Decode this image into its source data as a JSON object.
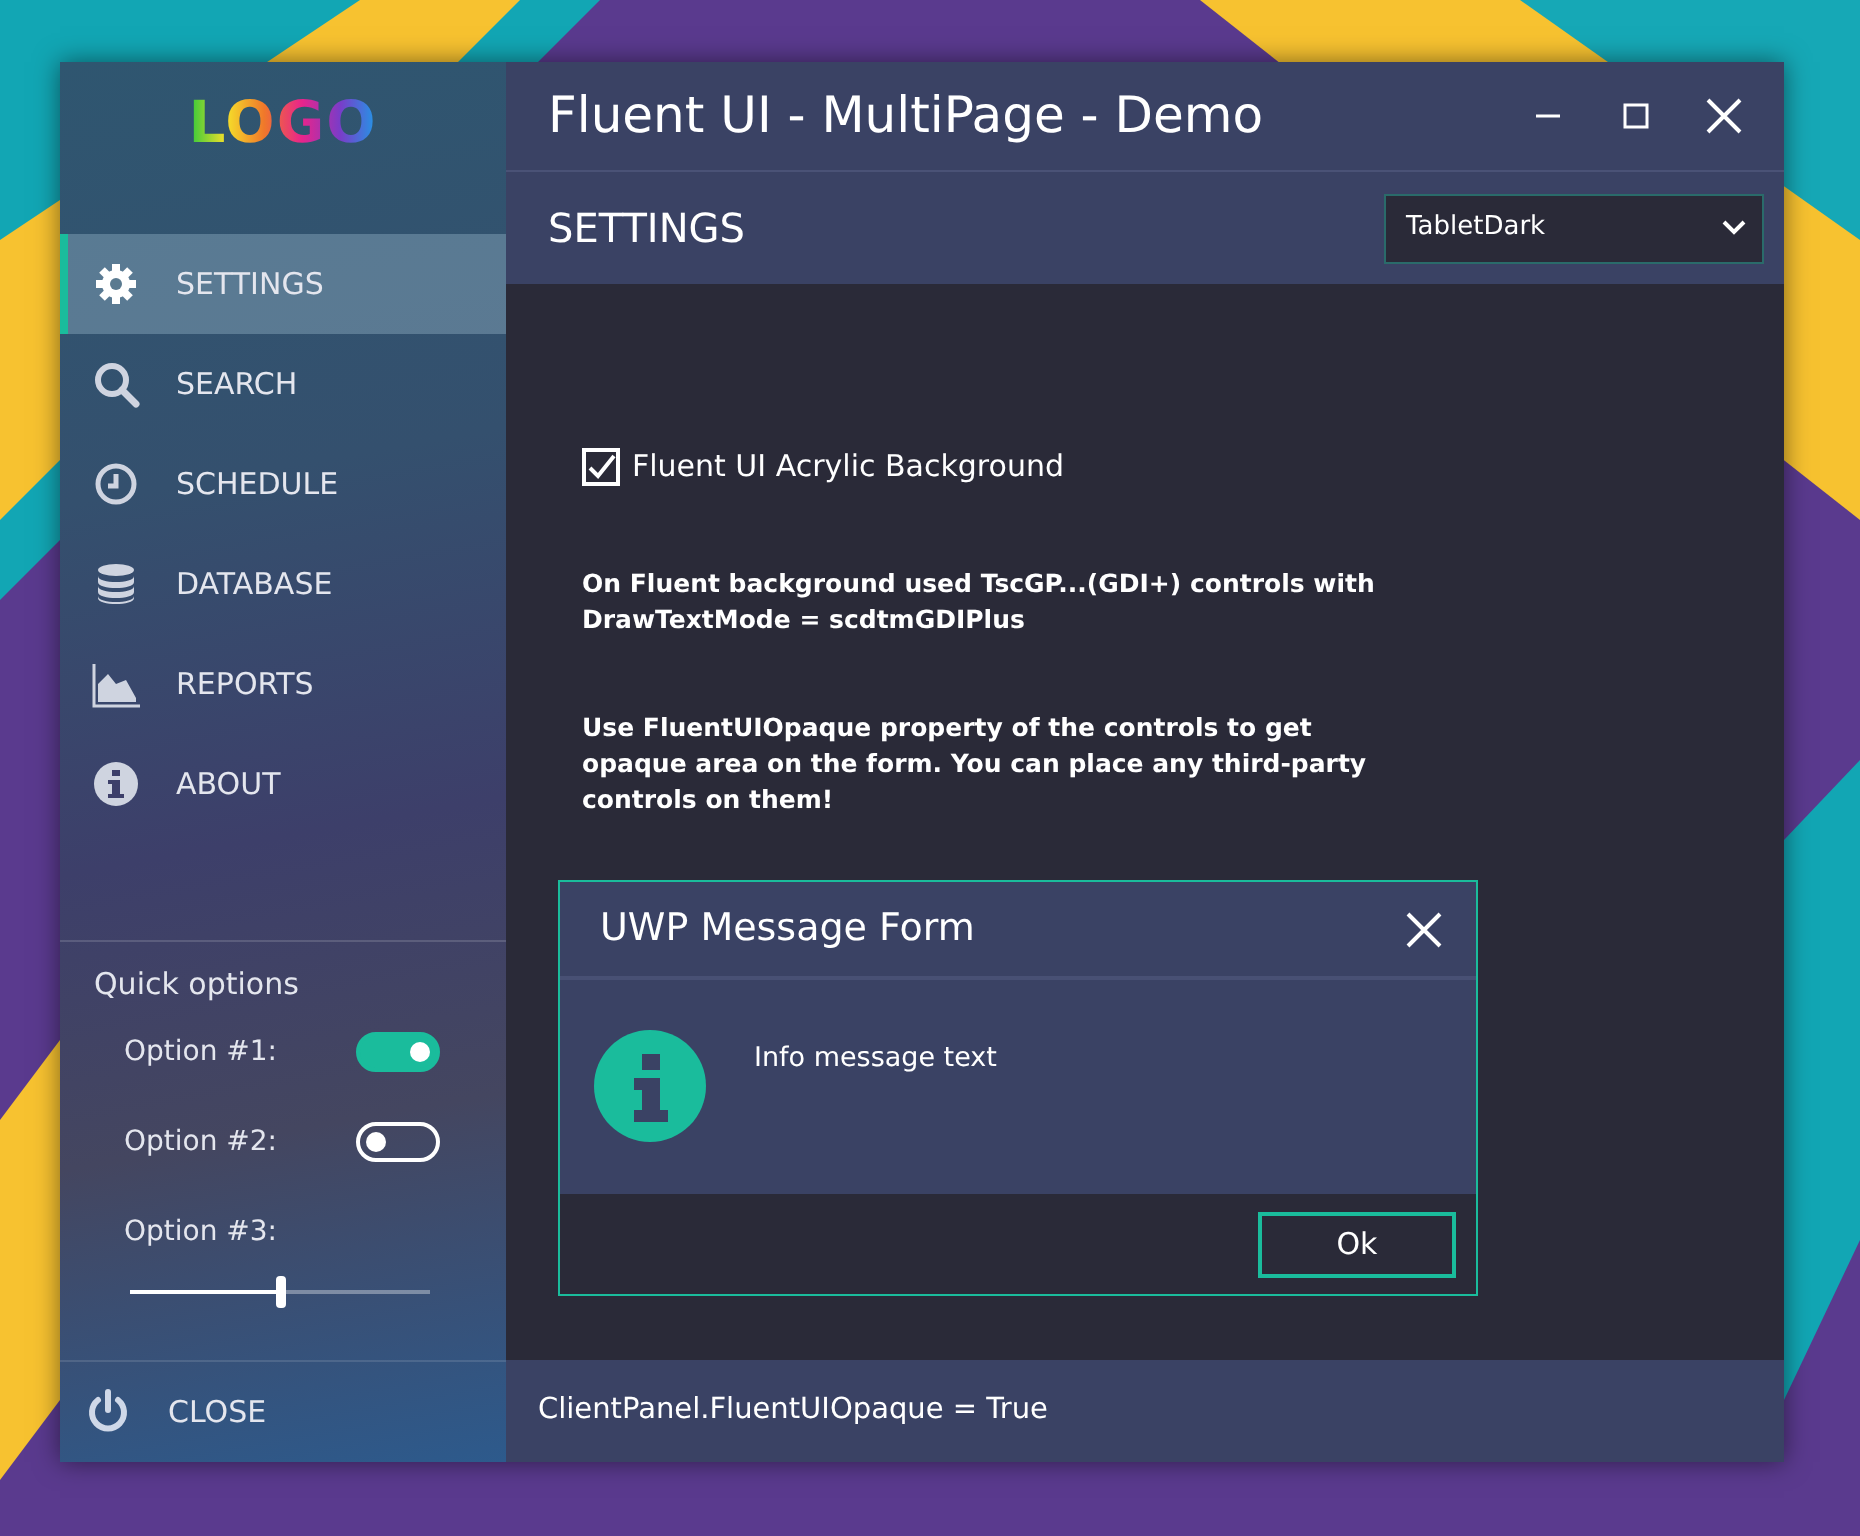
{
  "window": {
    "title": "Fluent UI - MultiPage - Demo"
  },
  "sidebar": {
    "logo": "LOGO",
    "items": [
      {
        "label": "SETTINGS",
        "selected": true
      },
      {
        "label": "SEARCH",
        "selected": false
      },
      {
        "label": "SCHEDULE",
        "selected": false
      },
      {
        "label": "DATABASE",
        "selected": false
      },
      {
        "label": "REPORTS",
        "selected": false
      },
      {
        "label": "ABOUT",
        "selected": false
      }
    ],
    "quick_options": {
      "title": "Quick options",
      "options": [
        {
          "label": "Option #1:",
          "kind": "toggle",
          "on": true
        },
        {
          "label": "Option #2:",
          "kind": "toggle",
          "on": false
        },
        {
          "label": "Option #3:",
          "kind": "slider",
          "level": 0.5
        }
      ]
    },
    "close": "CLOSE"
  },
  "header": {
    "title": "SETTINGS",
    "theme_select": "TabletDark"
  },
  "content": {
    "checkbox": {
      "label": "Fluent UI Acrylic Background",
      "checked": true
    },
    "notes": [
      "On Fluent background used TscGP...(GDI+) controls with DrawTextMode = scdtmGDIPlus",
      "Use FluentUIOpaque property of the controls to get opaque area on the form. You can place any third-party controls on them!"
    ]
  },
  "dialog": {
    "title": "UWP Message Form",
    "message": "Info message text",
    "button": "Ok"
  },
  "status_bar": "ClientPanel.FluentUIOpaque = True"
}
